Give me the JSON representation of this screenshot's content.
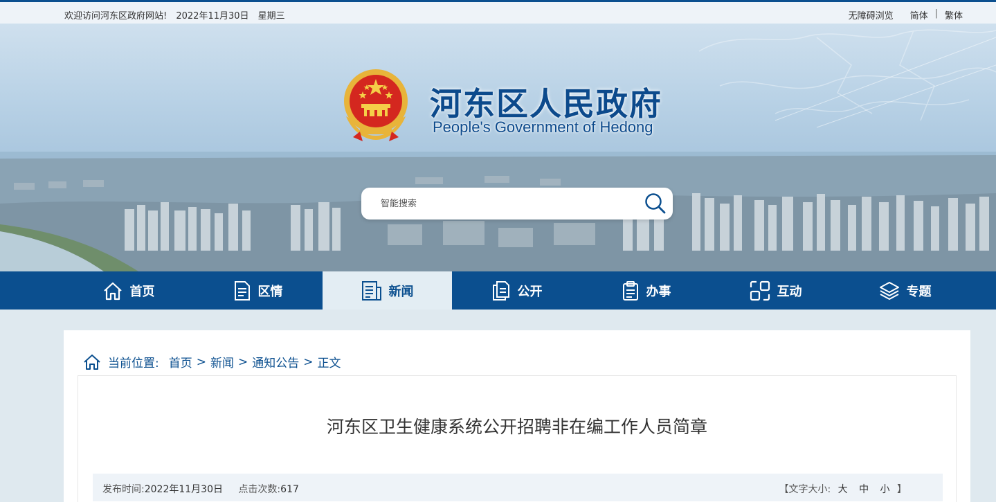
{
  "topbar": {
    "welcome": "欢迎访问河东区政府网站!",
    "date": "2022年11月30日",
    "weekday": "星期三",
    "accessibility": "无障碍浏览",
    "simplified": "简体",
    "separator": "|",
    "traditional": "繁体"
  },
  "header": {
    "title": "河东区人民政府",
    "subtitle": "People's Government of Hedong"
  },
  "search": {
    "placeholder": "智能搜索"
  },
  "nav": {
    "items": [
      {
        "label": "首页",
        "icon": "home-icon"
      },
      {
        "label": "区情",
        "icon": "document-icon"
      },
      {
        "label": "新闻",
        "icon": "news-icon",
        "active": true
      },
      {
        "label": "公开",
        "icon": "files-icon"
      },
      {
        "label": "办事",
        "icon": "clipboard-icon"
      },
      {
        "label": "互动",
        "icon": "interact-icon"
      },
      {
        "label": "专题",
        "icon": "layers-icon"
      }
    ]
  },
  "breadcrumb": {
    "label": "当前位置:",
    "items": [
      "首页",
      "新闻",
      "通知公告",
      "正文"
    ],
    "separator": ">"
  },
  "article": {
    "title": "河东区卫生健康系统公开招聘非在编工作人员简章",
    "publish_label": "发布时间:",
    "publish_date": "2022年11月30日",
    "views_label": "点击次数:",
    "views": "617",
    "font_size_open": "【文字大小:",
    "font_large": "大",
    "font_medium": "中",
    "font_small": "小",
    "font_size_close": "】"
  },
  "colors": {
    "brand": "#0b4f8f",
    "nav_active_bg": "#e3edf3",
    "page_bg": "#dfe9ef"
  }
}
